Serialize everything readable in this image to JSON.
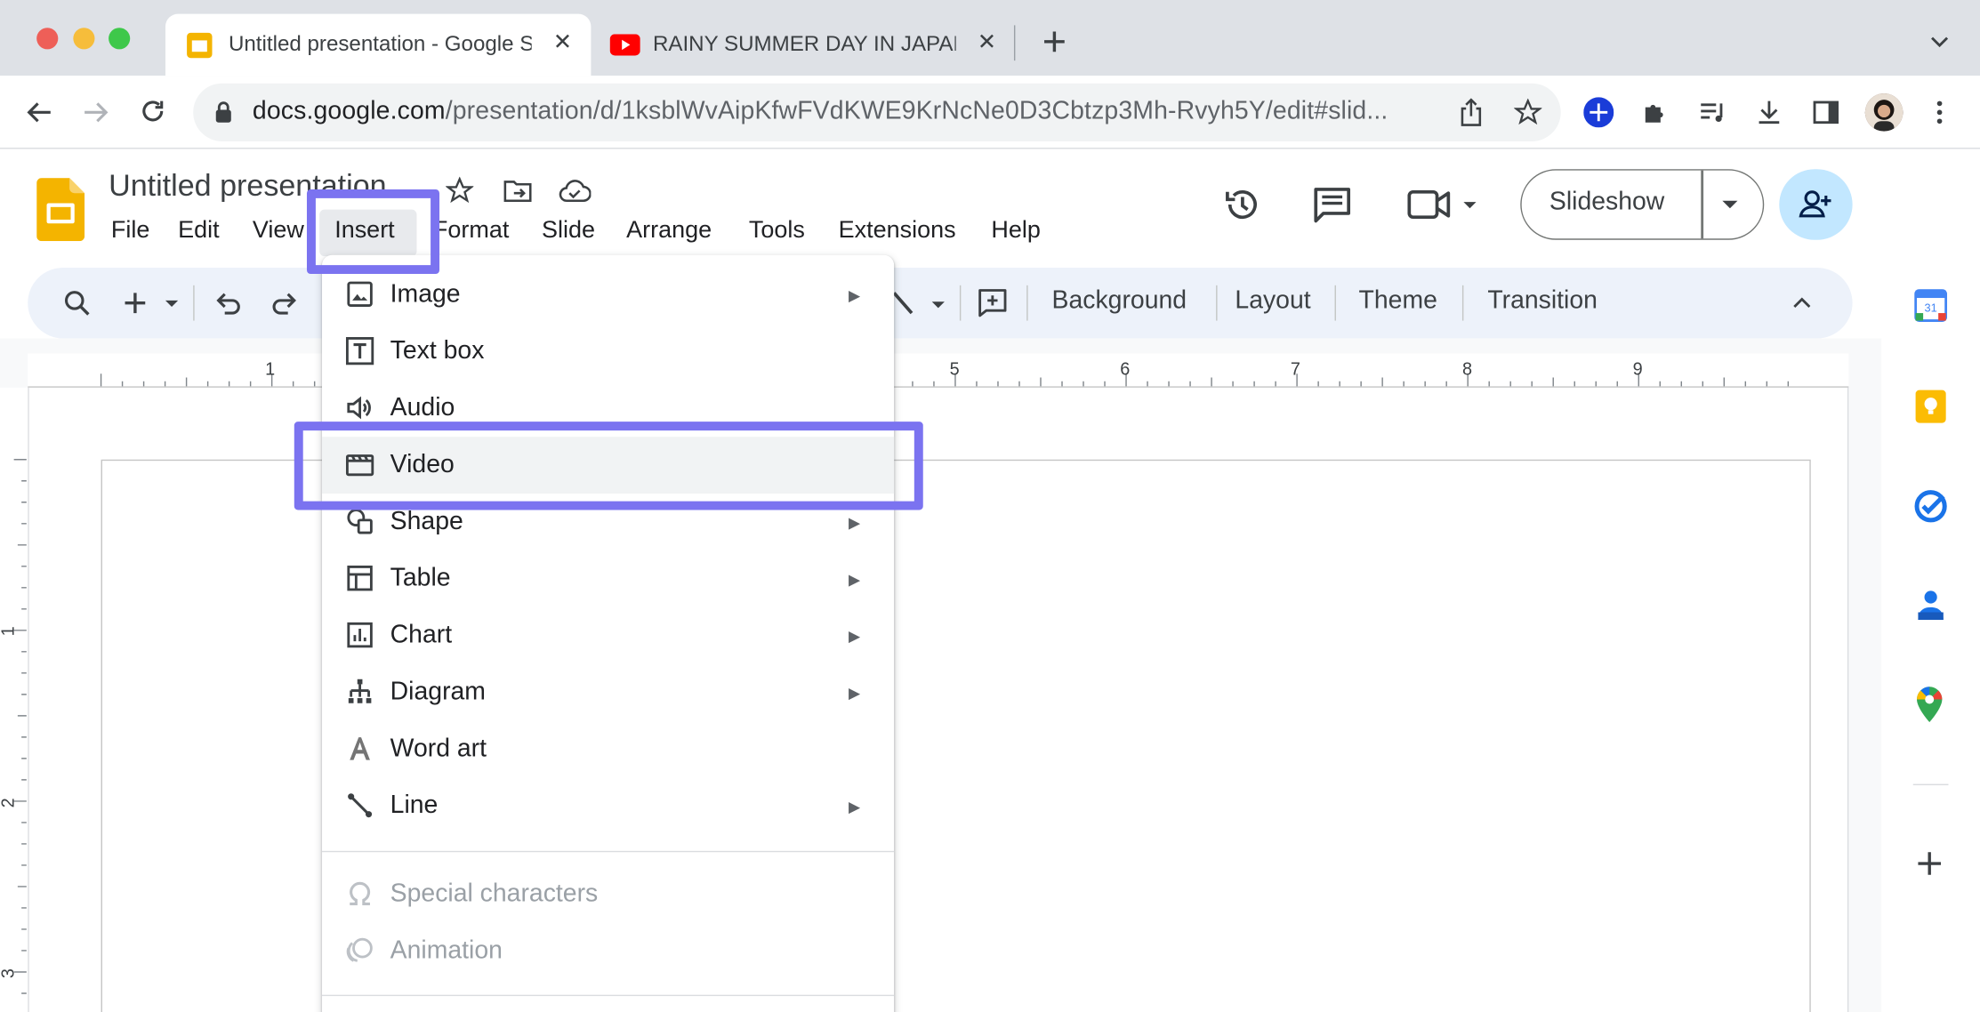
{
  "browser": {
    "tabs": [
      {
        "title": "Untitled presentation - Google Slides",
        "active": true
      },
      {
        "title": "RAINY SUMMER DAY IN JAPAN",
        "active": false
      }
    ],
    "url_host": "docs.google.com",
    "url_path": "/presentation/d/1ksblWvAipKfwFVdKWE9KrNcNe0D3Cbtzp3Mh-Rvyh5Y/edit#slid..."
  },
  "app": {
    "title": "Untitled presentation",
    "menus": [
      "File",
      "Edit",
      "View",
      "Insert",
      "Format",
      "Slide",
      "Arrange",
      "Tools",
      "Extensions",
      "Help"
    ],
    "slideshow_label": "Slideshow"
  },
  "toolbar": {
    "background_label": "Background",
    "layout_label": "Layout",
    "theme_label": "Theme",
    "transition_label": "Transition"
  },
  "ruler": {
    "h_numbers": [
      "1",
      "5",
      "6",
      "7",
      "8",
      "9"
    ],
    "v_numbers": [
      "1",
      "2",
      "3"
    ]
  },
  "side_panel": {
    "calendar_day": "31"
  },
  "insert_menu": {
    "items": [
      {
        "label": "Image",
        "icon": "image-icon",
        "submenu": true,
        "disabled": false
      },
      {
        "label": "Text box",
        "icon": "text-box-icon",
        "submenu": false,
        "disabled": false
      },
      {
        "label": "Audio",
        "icon": "audio-icon",
        "submenu": false,
        "disabled": false
      },
      {
        "label": "Video",
        "icon": "video-icon",
        "submenu": false,
        "disabled": false
      },
      {
        "label": "Shape",
        "icon": "shape-icon",
        "submenu": true,
        "disabled": false
      },
      {
        "label": "Table",
        "icon": "table-icon",
        "submenu": true,
        "disabled": false
      },
      {
        "label": "Chart",
        "icon": "chart-icon",
        "submenu": true,
        "disabled": false
      },
      {
        "label": "Diagram",
        "icon": "diagram-icon",
        "submenu": true,
        "disabled": false
      },
      {
        "label": "Word art",
        "icon": "word-art-icon",
        "submenu": false,
        "disabled": false
      },
      {
        "label": "Line",
        "icon": "line-icon",
        "submenu": true,
        "disabled": false
      },
      {
        "label": "Special characters",
        "icon": "omega-icon",
        "submenu": false,
        "disabled": true
      },
      {
        "label": "Animation",
        "icon": "animation-icon",
        "submenu": false,
        "disabled": true
      }
    ],
    "arrow_glyph": "▶"
  },
  "colors": {
    "annotation": "#7b73f0",
    "slides_yellow": "#f4b400",
    "share_bg": "#c2e7ff"
  }
}
